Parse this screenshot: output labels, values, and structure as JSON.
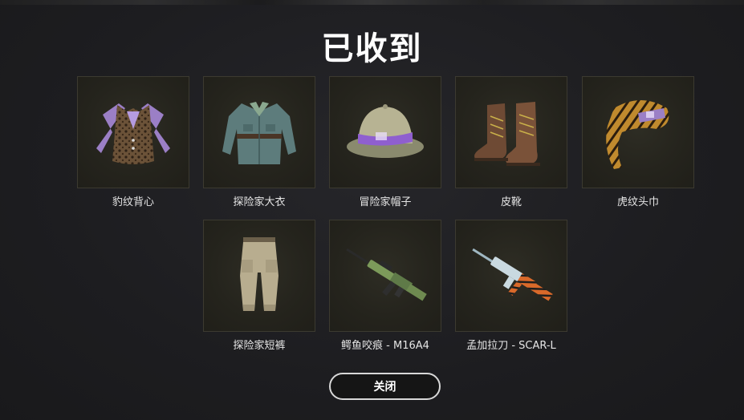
{
  "dialog": {
    "title": "已收到",
    "close_label": "关闭"
  },
  "items": [
    {
      "label": "豹纹背心",
      "icon": "leopard-vest-icon"
    },
    {
      "label": "探险家大衣",
      "icon": "explorer-coat-icon"
    },
    {
      "label": "冒险家帽子",
      "icon": "pith-helmet-icon"
    },
    {
      "label": "皮靴",
      "icon": "leather-boots-icon"
    },
    {
      "label": "虎纹头巾",
      "icon": "tiger-bandana-icon"
    },
    {
      "label": "探险家短裤",
      "icon": "explorer-pants-icon"
    },
    {
      "label": "鳄鱼咬痕 - M16A4",
      "icon": "m16a4-rifle-icon"
    },
    {
      "label": "孟加拉刀 - SCAR-L",
      "icon": "scar-l-rifle-icon"
    }
  ]
}
